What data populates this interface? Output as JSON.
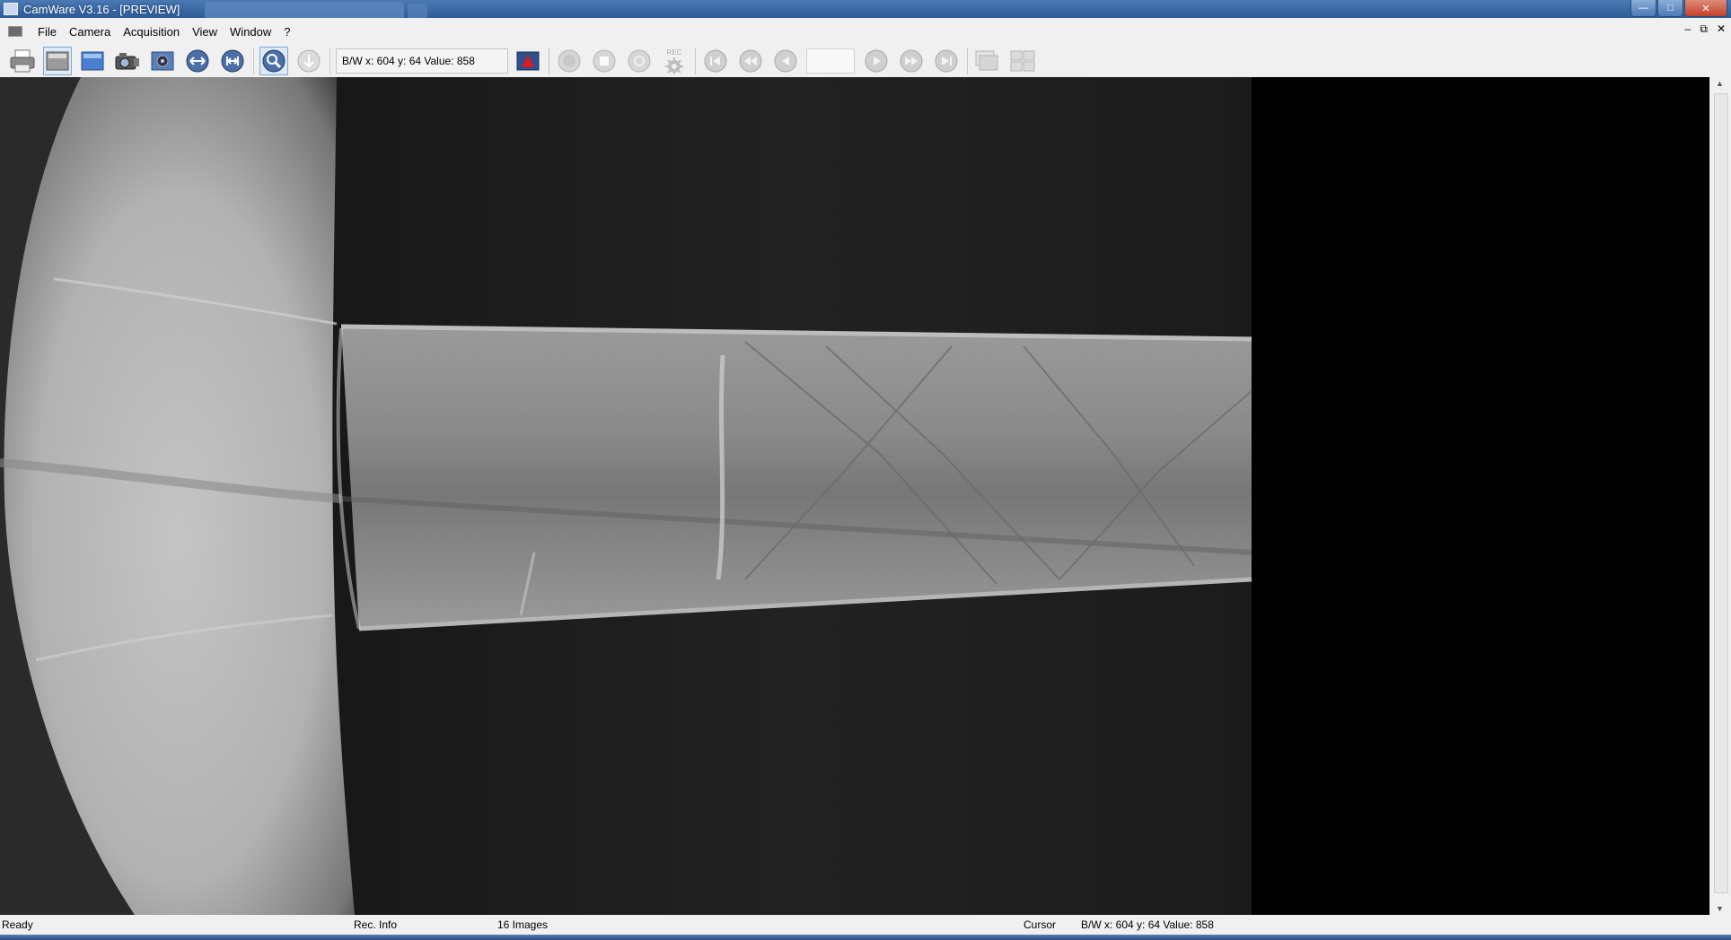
{
  "window": {
    "title": "CamWare V3.16 - [PREVIEW]"
  },
  "menu": {
    "items": [
      "File",
      "Camera",
      "Acquisition",
      "View",
      "Window",
      "?"
    ]
  },
  "toolbar": {
    "cursor_readout": "B/W x: 604 y:  64 Value: 858",
    "rec_label": "REC"
  },
  "statusbar": {
    "ready": "Ready",
    "rec_info": "Rec. Info",
    "images": "16 Images",
    "cursor_label": "Cursor",
    "cursor_value": "B/W x: 604 y:  64 Value: 858"
  },
  "icons": {
    "print": "print-icon",
    "preview": "preview-icon",
    "live": "live-image-icon",
    "camera": "camera-icon",
    "settings": "camera-settings-icon",
    "fit": "fit-width-icon",
    "fit_all": "fit-all-icon",
    "zoom": "zoom-icon",
    "download": "download-icon",
    "color": "color-lut-icon",
    "record": "record-icon",
    "stop": "stop-icon",
    "pause": "pause-icon",
    "rec_settings": "rec-settings-icon",
    "first": "first-frame-icon",
    "rewind": "rewind-icon",
    "back": "step-back-icon",
    "play": "play-icon",
    "forward": "fast-forward-icon",
    "last": "last-frame-icon",
    "cascade": "cascade-windows-icon",
    "tile": "tile-windows-icon"
  },
  "colors": {
    "titlebar": "#3a68a6",
    "background": "#f0f0f0",
    "image_bg": "#000000"
  }
}
